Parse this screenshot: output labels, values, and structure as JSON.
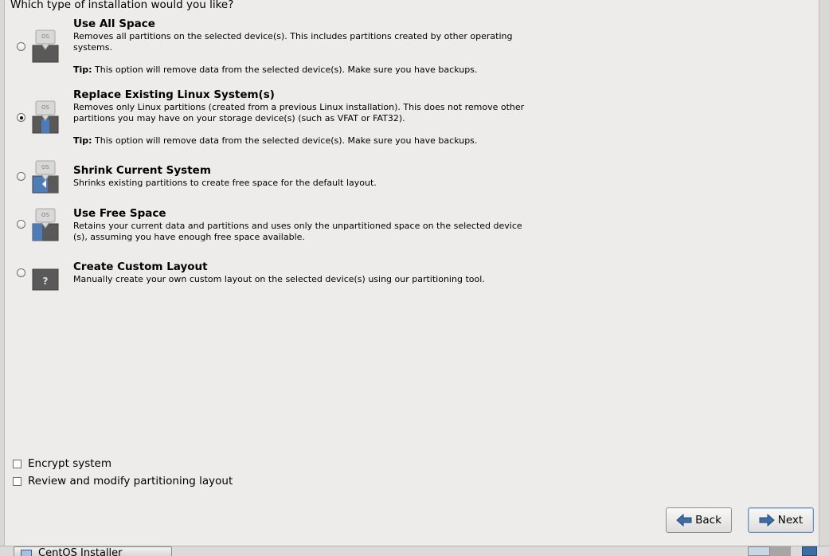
{
  "question": "Which type of installation would you like?",
  "options": [
    {
      "title": "Use All Space",
      "desc_lines": [
        "Removes all partitions on the selected device(s).  This includes partitions created by other operating",
        "systems."
      ],
      "tip_label": "Tip:",
      "tip_text": " This option will remove data from the selected device(s).  Make sure you have backups.",
      "selected": false,
      "icon": "disk-use-all-icon"
    },
    {
      "title": "Replace Existing Linux System(s)",
      "desc_lines": [
        "Removes only Linux partitions (created from a previous Linux installation).  This does not remove other",
        "partitions you may have on your storage device(s) (such as VFAT or FAT32)."
      ],
      "tip_label": "Tip:",
      "tip_text": " This option will remove data from the selected device(s).  Make sure you have backups.",
      "selected": true,
      "icon": "disk-replace-linux-icon"
    },
    {
      "title": "Shrink Current System",
      "desc_lines": [
        "Shrinks existing partitions to create free space for the default layout."
      ],
      "selected": false,
      "icon": "disk-shrink-icon"
    },
    {
      "title": "Use Free Space",
      "desc_lines": [
        "Retains your current data and partitions and uses only the unpartitioned space on the selected device",
        "(s), assuming you have enough free space available."
      ],
      "selected": false,
      "icon": "disk-free-space-icon"
    },
    {
      "title": "Create Custom Layout",
      "desc_lines": [
        "Manually create your own custom layout on the selected device(s) using our partitioning tool."
      ],
      "selected": false,
      "icon": "disk-custom-icon"
    }
  ],
  "checkboxes": {
    "encrypt": {
      "label": "Encrypt system",
      "checked": false
    },
    "review": {
      "label": "Review and modify partitioning layout",
      "checked": false
    }
  },
  "buttons": {
    "back": "Back",
    "next": "Next"
  },
  "taskbar": {
    "window_title": "CentOS Installer"
  },
  "icon_text": {
    "os": "OS",
    "custom": "?"
  },
  "colors": {
    "background": "#edeceb",
    "accent": "#3a6ea5",
    "disk_grey": "#5a5a5a",
    "disk_blue": "#4d7db8"
  }
}
